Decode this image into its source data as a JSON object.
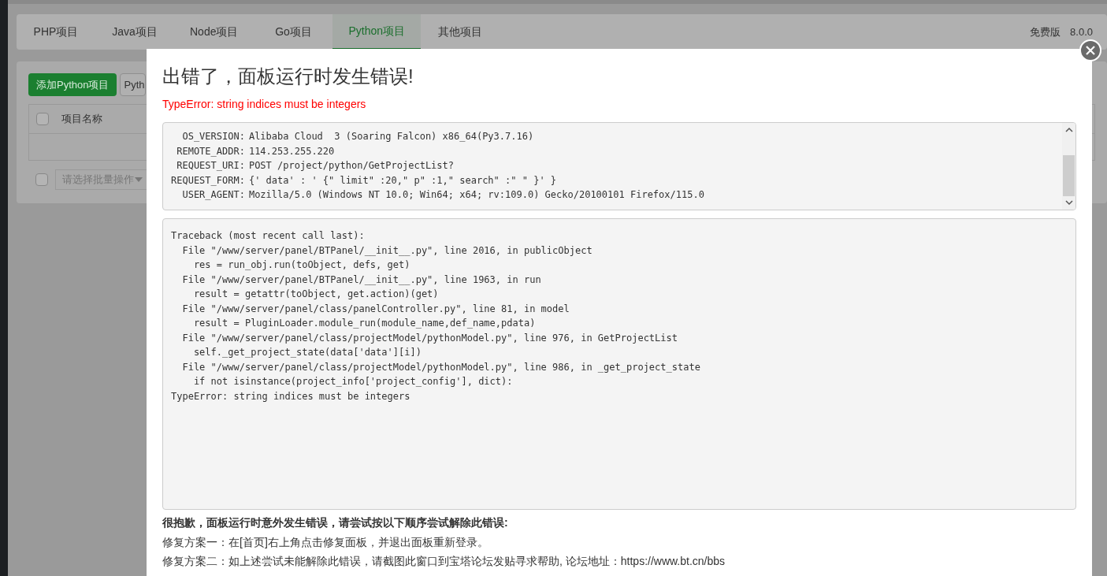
{
  "tabs": [
    {
      "label": "PHP项目",
      "selected": false
    },
    {
      "label": "Java项目",
      "selected": false
    },
    {
      "label": "Node项目",
      "selected": false
    },
    {
      "label": "Go项目",
      "selected": false
    },
    {
      "label": "Python项目",
      "selected": true
    },
    {
      "label": "其他项目",
      "selected": false
    }
  ],
  "edition": "免费版",
  "version": "8.0.0",
  "toolbar": {
    "add_button": "添加Python项目",
    "second_button": "Pyth"
  },
  "table": {
    "columns": [
      "项目名称"
    ],
    "select_all_checked": false
  },
  "batch_select": {
    "placeholder": "请选择批量操作",
    "checked": false
  },
  "dialog": {
    "title": "出错了，面板运行时发生错误!",
    "error": "TypeError: string indices must be integers",
    "environment": [
      {
        "key": "OS_VERSION:",
        "value": "Alibaba Cloud  3 (Soaring Falcon) x86_64(Py3.7.16)"
      },
      {
        "key": "REMOTE_ADDR:",
        "value": "114.253.255.220"
      },
      {
        "key": "REQUEST_URI:",
        "value": "POST /project/python/GetProjectList?"
      },
      {
        "key": "REQUEST_FORM:",
        "value": "{' data' : ' {\" limit\" :20,\" p\" :1,\" search\" :\" \" }' }"
      },
      {
        "key": "USER_AGENT:",
        "value": "Mozilla/5.0 (Windows NT 10.0; Win64; x64; rv:109.0) Gecko/20100101 Firefox/115.0"
      }
    ],
    "traceback": [
      "Traceback (most recent call last):",
      "  File \"/www/server/panel/BTPanel/__init__.py\", line 2016, in publicObject",
      "    res = run_obj.run(toObject, defs, get)",
      "  File \"/www/server/panel/BTPanel/__init__.py\", line 1963, in run",
      "    result = getattr(toObject, get.action)(get)",
      "  File \"/www/server/panel/class/panelController.py\", line 81, in model",
      "    result = PluginLoader.module_run(module_name,def_name,pdata)",
      "  File \"/www/server/panel/class/projectModel/pythonModel.py\", line 976, in GetProjectList",
      "    self._get_project_state(data['data'][i])",
      "  File \"/www/server/panel/class/projectModel/pythonModel.py\", line 986, in _get_project_state",
      "    if not isinstance(project_info['project_config'], dict):",
      "TypeError: string indices must be integers"
    ],
    "help_heading": "很抱歉，面板运行时意外发生错误，请尝试按以下顺序尝试解除此错误:",
    "help_steps": [
      "修复方案一：在[首页]右上角点击修复面板，并退出面板重新登录。",
      "修复方案二：如上述尝试未能解除此错误，请截图此窗口到宝塔论坛发贴寻求帮助, 论坛地址：https://www.bt.cn/bbs"
    ]
  }
}
